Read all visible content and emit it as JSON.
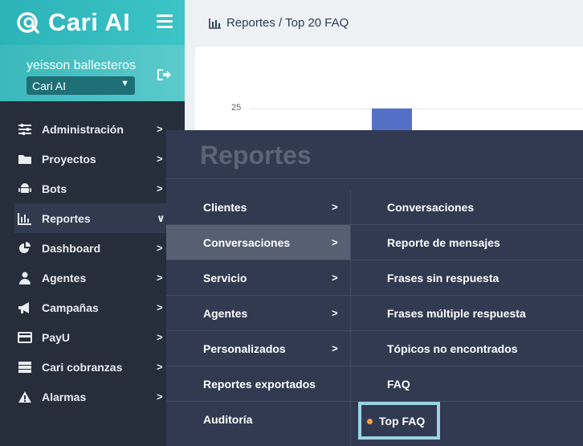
{
  "brand": {
    "name": "Cari AI"
  },
  "user": {
    "name": "yeisson ballesteros",
    "selected_bot": "Cari AI"
  },
  "sidebar": {
    "items": [
      {
        "label": "Administración",
        "icon": "sliders-icon"
      },
      {
        "label": "Proyectos",
        "icon": "folder-icon"
      },
      {
        "label": "Bots",
        "icon": "android-icon"
      },
      {
        "label": "Reportes",
        "icon": "bar-chart-icon",
        "active": true
      },
      {
        "label": "Dashboard",
        "icon": "pie-chart-icon"
      },
      {
        "label": "Agentes",
        "icon": "user-icon"
      },
      {
        "label": "Campañas",
        "icon": "megaphone-icon"
      },
      {
        "label": "PayU",
        "icon": "credit-card-icon"
      },
      {
        "label": "Cari cobranzas",
        "icon": "server-icon"
      },
      {
        "label": "Alarmas",
        "icon": "warning-icon"
      }
    ]
  },
  "breadcrumb": {
    "text": "Reportes / Top 20 FAQ"
  },
  "chart": {
    "tick_label": "25"
  },
  "mega_menu": {
    "title": "Reportes",
    "left_items": [
      {
        "label": "Clientes",
        "has_sub": true
      },
      {
        "label": "Conversaciones",
        "has_sub": true,
        "active": true
      },
      {
        "label": "Servicio",
        "has_sub": true
      },
      {
        "label": "Agentes",
        "has_sub": true
      },
      {
        "label": "Personalizados",
        "has_sub": true
      },
      {
        "label": "Reportes exportados",
        "has_sub": false
      },
      {
        "label": "Auditoría",
        "has_sub": false
      }
    ],
    "right_items": [
      {
        "label": "Conversaciones"
      },
      {
        "label": "Reporte de mensajes"
      },
      {
        "label": "Frases sin respuesta"
      },
      {
        "label": "Frases múltiple respuesta"
      },
      {
        "label": "Tópicos no encontrados"
      },
      {
        "label": "FAQ"
      },
      {
        "label": "Top FAQ",
        "current": true
      }
    ]
  },
  "colors": {
    "accent": "#3cc4c6",
    "sidebar_bg": "#262d3b",
    "menu_bg": "#323a52",
    "highlight": "#9ad4e4",
    "dot": "#f0a24a"
  }
}
